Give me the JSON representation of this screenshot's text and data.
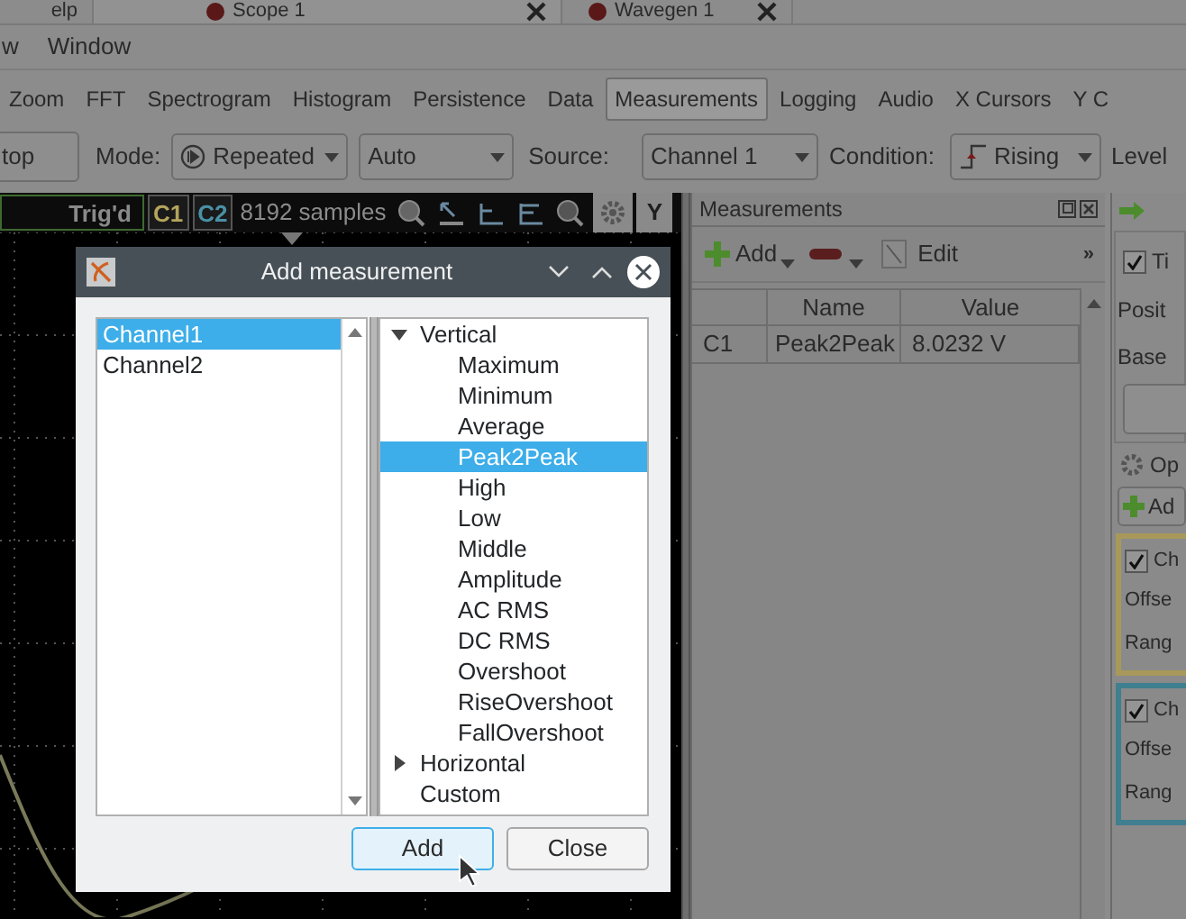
{
  "top_tabs": [
    {
      "label": "elp",
      "selected": false,
      "closable": false
    },
    {
      "label": "Scope 1",
      "selected": true,
      "closable": true
    },
    {
      "label": "Wavegen 1",
      "selected": false,
      "closable": true
    }
  ],
  "menu": [
    "w",
    "Window"
  ],
  "view_tabs": [
    {
      "label": "Zoom",
      "selected": false
    },
    {
      "label": "FFT",
      "selected": false
    },
    {
      "label": "Spectrogram",
      "selected": false
    },
    {
      "label": "Histogram",
      "selected": false
    },
    {
      "label": "Persistence",
      "selected": false
    },
    {
      "label": "Data",
      "selected": false
    },
    {
      "label": "Measurements",
      "selected": true
    },
    {
      "label": "Logging",
      "selected": false
    },
    {
      "label": "Audio",
      "selected": false
    },
    {
      "label": "X Cursors",
      "selected": false
    },
    {
      "label": "Y C",
      "selected": false
    }
  ],
  "trigger_bar": {
    "button": "top",
    "mode_label": "Mode:",
    "mode": "Repeated",
    "auto": "Auto",
    "source_label": "Source:",
    "source": "Channel 1",
    "condition_label": "Condition:",
    "condition": "Rising",
    "level_label": "Level"
  },
  "scope": {
    "status": "Trig'd",
    "channels": [
      {
        "label": "C1",
        "color": "#b4a45c"
      },
      {
        "label": "C2",
        "color": "#4a90a6"
      }
    ],
    "samples": "8192 samples",
    "y_button": "Y"
  },
  "measurements_panel": {
    "title": "Measurements",
    "add": "Add",
    "edit": "Edit",
    "more": "»",
    "columns": [
      "Name",
      "Value"
    ],
    "rows": [
      {
        "channel": "C1",
        "name": "Peak2Peak",
        "value": "8.0232 V"
      }
    ]
  },
  "right_panel": {
    "time": {
      "label": "Ti",
      "checked": true
    },
    "fields": [
      "Posit",
      "Base"
    ],
    "options": "Op",
    "add": "Ad",
    "channel_groups": [
      {
        "label": "Ch",
        "checked": true,
        "color": "#a8995a",
        "fields": [
          "Offse",
          "Rang"
        ]
      },
      {
        "label": "Ch",
        "checked": true,
        "color": "#3f7f90",
        "fields": [
          "Offse",
          "Rang"
        ]
      }
    ]
  },
  "dialog": {
    "title": "Add measurement",
    "channels": [
      {
        "label": "Channel1",
        "selected": true
      },
      {
        "label": "Channel2",
        "selected": false
      }
    ],
    "tree": [
      {
        "label": "Vertical",
        "expanded": true,
        "children": [
          {
            "label": "Maximum",
            "selected": false
          },
          {
            "label": "Minimum",
            "selected": false
          },
          {
            "label": "Average",
            "selected": false
          },
          {
            "label": "Peak2Peak",
            "selected": true
          },
          {
            "label": "High",
            "selected": false
          },
          {
            "label": "Low",
            "selected": false
          },
          {
            "label": "Middle",
            "selected": false
          },
          {
            "label": "Amplitude",
            "selected": false
          },
          {
            "label": "AC RMS",
            "selected": false
          },
          {
            "label": "DC RMS",
            "selected": false
          },
          {
            "label": "Overshoot",
            "selected": false
          },
          {
            "label": "RiseOvershoot",
            "selected": false
          },
          {
            "label": "FallOvershoot",
            "selected": false
          }
        ]
      },
      {
        "label": "Horizontal",
        "expanded": false
      },
      {
        "label": "Custom"
      }
    ],
    "buttons": [
      "Add",
      "Close"
    ]
  }
}
